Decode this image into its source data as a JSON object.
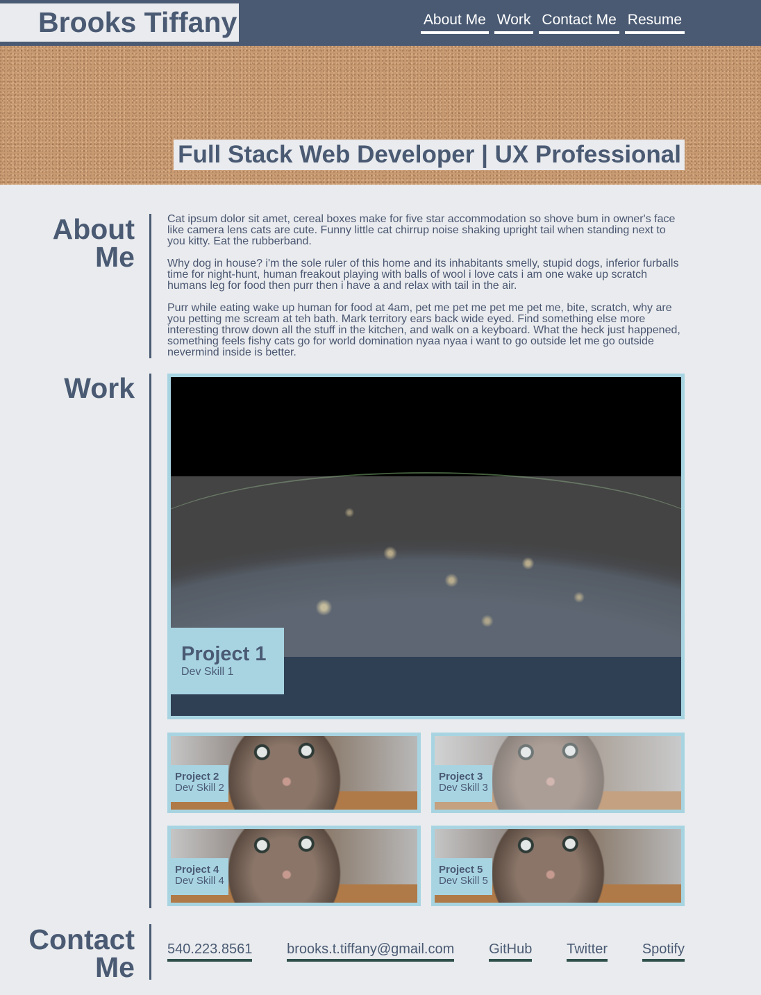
{
  "header": {
    "brand": "Brooks Tiffany",
    "nav": [
      "About Me",
      "Work",
      "Contact Me",
      "Resume"
    ]
  },
  "hero": {
    "tagline": "Full Stack Web Developer | UX Professional"
  },
  "about": {
    "title_line1": "About",
    "title_line2": "Me",
    "paragraphs": [
      "Cat ipsum dolor sit amet, cereal boxes make for five star accommodation so shove bum in owner's face like camera lens cats are cute. Funny little cat chirrup noise shaking upright tail when standing next to you kitty. Eat the rubberband.",
      "Why dog in house? i'm the sole ruler of this home and its inhabitants smelly, stupid dogs, inferior furballs time for night-hunt, human freakout playing with balls of wool i love cats i am one wake up scratch humans leg for food then purr then i have a and relax with tail in the air.",
      "Purr while eating wake up human for food at 4am, pet me pet me pet me pet me, bite, scratch, why are you petting me scream at teh bath. Mark territory ears back wide eyed. Find something else more interesting throw down all the stuff in the kitchen, and walk on a keyboard. What the heck just happened, something feels fishy cats go for world domination nyaa nyaa i want to go outside let me go outside nevermind inside is better."
    ]
  },
  "work": {
    "title": "Work",
    "projects": [
      {
        "title": "Project 1",
        "skill": "Dev Skill 1"
      },
      {
        "title": "Project 2",
        "skill": "Dev Skill 2"
      },
      {
        "title": "Project 3",
        "skill": "Dev Skill 3"
      },
      {
        "title": "Project 4",
        "skill": "Dev Skill 4"
      },
      {
        "title": "Project 5",
        "skill": "Dev Skill 5"
      }
    ]
  },
  "contact": {
    "title_line1": "Contact",
    "title_line2": "Me",
    "links": [
      "540.223.8561",
      "brooks.t.tiffany@gmail.com",
      "GitHub",
      "Twitter",
      "Spotify"
    ]
  },
  "colors": {
    "primary": "#4a5a73",
    "background": "#e9ebee",
    "accent": "#a8d4e2",
    "contact_underline": "#2f4f4a"
  }
}
